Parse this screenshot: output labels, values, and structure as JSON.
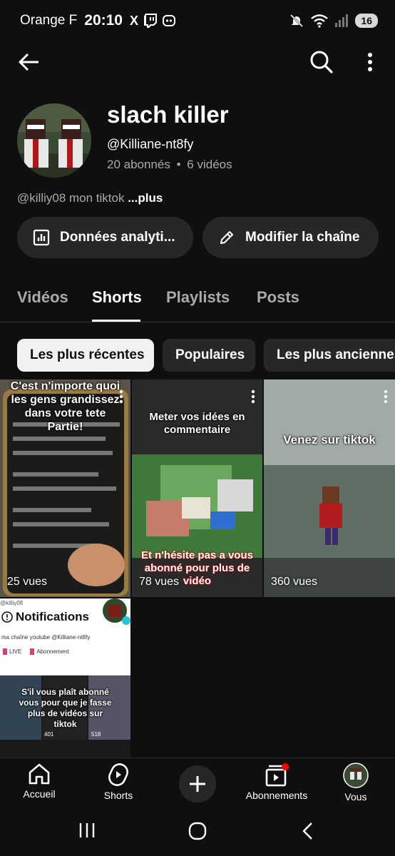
{
  "status_bar": {
    "carrier": "Orange F",
    "time": "20:10",
    "app_icons": [
      "X",
      "twitch-icon",
      "discord-icon"
    ],
    "battery": "16"
  },
  "top_bar": {
    "icons": [
      "back-arrow-icon",
      "search-icon",
      "more-vertical-icon"
    ]
  },
  "channel": {
    "name": "slach killer",
    "handle": "@Killiane-nt8fy",
    "subscribers": "20 abonnés",
    "separator": "•",
    "videos": "6 vidéos",
    "description": "@killiy08 mon tiktok",
    "more_label": "...plus"
  },
  "actions": {
    "analytics_label": "Données analyti...",
    "edit_label": "Modifier la chaîne"
  },
  "tabs": [
    {
      "label": "Vidéos",
      "active": false
    },
    {
      "label": "Shorts",
      "active": true
    },
    {
      "label": "Playlists",
      "active": false
    },
    {
      "label": "Posts",
      "active": false
    }
  ],
  "chips": [
    {
      "label": "Les plus récentes",
      "selected": true
    },
    {
      "label": "Populaires",
      "selected": false
    },
    {
      "label": "Les plus anciennes",
      "selected": false
    }
  ],
  "shorts": [
    {
      "views": "25 vues",
      "overlay": "C'est n'importe quoi les gens grandissez dans votre tete Partie!"
    },
    {
      "views": "78 vues",
      "overlay_top": "Meter vos idées en commentaire",
      "overlay_bottom": "Et n'hésite pas a vous abonné pour plus de vidéo"
    },
    {
      "views": "360 vues",
      "overlay": "Venez sur tiktok"
    },
    {
      "handle": "@killiy08",
      "notif_title": "Notifications",
      "line": "ma chaîne youtube @Killiane-nt8fy",
      "live": "LIVE",
      "abonnement": "Abonnement",
      "overlay": "S'il vous plaît abonné vous pour que je fasse plus de vidéos sur tiktok",
      "mini_a": "401",
      "mini_b": "518"
    }
  ],
  "bottom_nav": [
    {
      "label": "Accueil",
      "icon": "home-icon"
    },
    {
      "label": "Shorts",
      "icon": "shorts-icon"
    },
    {
      "label": "",
      "icon": "plus-icon"
    },
    {
      "label": "Abonnements",
      "icon": "subscriptions-icon"
    },
    {
      "label": "Vous",
      "icon": "avatar-icon"
    }
  ],
  "colors": {
    "background": "#0f0f0f",
    "surface": "#272727",
    "text_secondary": "#aaaaaa",
    "notification_dot": "#ff0000"
  }
}
